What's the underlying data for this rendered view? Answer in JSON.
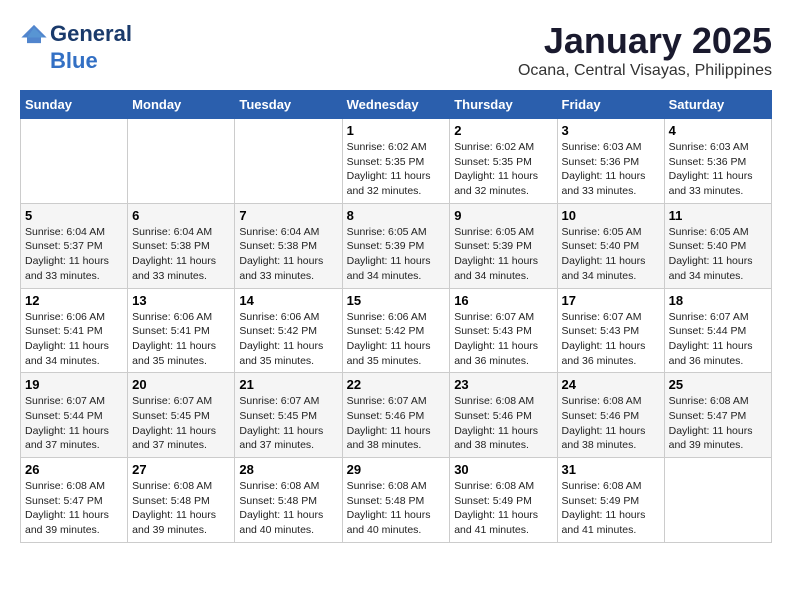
{
  "header": {
    "logo_general": "General",
    "logo_blue": "Blue",
    "month_title": "January 2025",
    "location": "Ocana, Central Visayas, Philippines"
  },
  "weekdays": [
    "Sunday",
    "Monday",
    "Tuesday",
    "Wednesday",
    "Thursday",
    "Friday",
    "Saturday"
  ],
  "weeks": [
    [
      {
        "day": "",
        "sunrise": "",
        "sunset": "",
        "daylight": ""
      },
      {
        "day": "",
        "sunrise": "",
        "sunset": "",
        "daylight": ""
      },
      {
        "day": "",
        "sunrise": "",
        "sunset": "",
        "daylight": ""
      },
      {
        "day": "1",
        "sunrise": "Sunrise: 6:02 AM",
        "sunset": "Sunset: 5:35 PM",
        "daylight": "Daylight: 11 hours and 32 minutes."
      },
      {
        "day": "2",
        "sunrise": "Sunrise: 6:02 AM",
        "sunset": "Sunset: 5:35 PM",
        "daylight": "Daylight: 11 hours and 32 minutes."
      },
      {
        "day": "3",
        "sunrise": "Sunrise: 6:03 AM",
        "sunset": "Sunset: 5:36 PM",
        "daylight": "Daylight: 11 hours and 33 minutes."
      },
      {
        "day": "4",
        "sunrise": "Sunrise: 6:03 AM",
        "sunset": "Sunset: 5:36 PM",
        "daylight": "Daylight: 11 hours and 33 minutes."
      }
    ],
    [
      {
        "day": "5",
        "sunrise": "Sunrise: 6:04 AM",
        "sunset": "Sunset: 5:37 PM",
        "daylight": "Daylight: 11 hours and 33 minutes."
      },
      {
        "day": "6",
        "sunrise": "Sunrise: 6:04 AM",
        "sunset": "Sunset: 5:38 PM",
        "daylight": "Daylight: 11 hours and 33 minutes."
      },
      {
        "day": "7",
        "sunrise": "Sunrise: 6:04 AM",
        "sunset": "Sunset: 5:38 PM",
        "daylight": "Daylight: 11 hours and 33 minutes."
      },
      {
        "day": "8",
        "sunrise": "Sunrise: 6:05 AM",
        "sunset": "Sunset: 5:39 PM",
        "daylight": "Daylight: 11 hours and 34 minutes."
      },
      {
        "day": "9",
        "sunrise": "Sunrise: 6:05 AM",
        "sunset": "Sunset: 5:39 PM",
        "daylight": "Daylight: 11 hours and 34 minutes."
      },
      {
        "day": "10",
        "sunrise": "Sunrise: 6:05 AM",
        "sunset": "Sunset: 5:40 PM",
        "daylight": "Daylight: 11 hours and 34 minutes."
      },
      {
        "day": "11",
        "sunrise": "Sunrise: 6:05 AM",
        "sunset": "Sunset: 5:40 PM",
        "daylight": "Daylight: 11 hours and 34 minutes."
      }
    ],
    [
      {
        "day": "12",
        "sunrise": "Sunrise: 6:06 AM",
        "sunset": "Sunset: 5:41 PM",
        "daylight": "Daylight: 11 hours and 34 minutes."
      },
      {
        "day": "13",
        "sunrise": "Sunrise: 6:06 AM",
        "sunset": "Sunset: 5:41 PM",
        "daylight": "Daylight: 11 hours and 35 minutes."
      },
      {
        "day": "14",
        "sunrise": "Sunrise: 6:06 AM",
        "sunset": "Sunset: 5:42 PM",
        "daylight": "Daylight: 11 hours and 35 minutes."
      },
      {
        "day": "15",
        "sunrise": "Sunrise: 6:06 AM",
        "sunset": "Sunset: 5:42 PM",
        "daylight": "Daylight: 11 hours and 35 minutes."
      },
      {
        "day": "16",
        "sunrise": "Sunrise: 6:07 AM",
        "sunset": "Sunset: 5:43 PM",
        "daylight": "Daylight: 11 hours and 36 minutes."
      },
      {
        "day": "17",
        "sunrise": "Sunrise: 6:07 AM",
        "sunset": "Sunset: 5:43 PM",
        "daylight": "Daylight: 11 hours and 36 minutes."
      },
      {
        "day": "18",
        "sunrise": "Sunrise: 6:07 AM",
        "sunset": "Sunset: 5:44 PM",
        "daylight": "Daylight: 11 hours and 36 minutes."
      }
    ],
    [
      {
        "day": "19",
        "sunrise": "Sunrise: 6:07 AM",
        "sunset": "Sunset: 5:44 PM",
        "daylight": "Daylight: 11 hours and 37 minutes."
      },
      {
        "day": "20",
        "sunrise": "Sunrise: 6:07 AM",
        "sunset": "Sunset: 5:45 PM",
        "daylight": "Daylight: 11 hours and 37 minutes."
      },
      {
        "day": "21",
        "sunrise": "Sunrise: 6:07 AM",
        "sunset": "Sunset: 5:45 PM",
        "daylight": "Daylight: 11 hours and 37 minutes."
      },
      {
        "day": "22",
        "sunrise": "Sunrise: 6:07 AM",
        "sunset": "Sunset: 5:46 PM",
        "daylight": "Daylight: 11 hours and 38 minutes."
      },
      {
        "day": "23",
        "sunrise": "Sunrise: 6:08 AM",
        "sunset": "Sunset: 5:46 PM",
        "daylight": "Daylight: 11 hours and 38 minutes."
      },
      {
        "day": "24",
        "sunrise": "Sunrise: 6:08 AM",
        "sunset": "Sunset: 5:46 PM",
        "daylight": "Daylight: 11 hours and 38 minutes."
      },
      {
        "day": "25",
        "sunrise": "Sunrise: 6:08 AM",
        "sunset": "Sunset: 5:47 PM",
        "daylight": "Daylight: 11 hours and 39 minutes."
      }
    ],
    [
      {
        "day": "26",
        "sunrise": "Sunrise: 6:08 AM",
        "sunset": "Sunset: 5:47 PM",
        "daylight": "Daylight: 11 hours and 39 minutes."
      },
      {
        "day": "27",
        "sunrise": "Sunrise: 6:08 AM",
        "sunset": "Sunset: 5:48 PM",
        "daylight": "Daylight: 11 hours and 39 minutes."
      },
      {
        "day": "28",
        "sunrise": "Sunrise: 6:08 AM",
        "sunset": "Sunset: 5:48 PM",
        "daylight": "Daylight: 11 hours and 40 minutes."
      },
      {
        "day": "29",
        "sunrise": "Sunrise: 6:08 AM",
        "sunset": "Sunset: 5:48 PM",
        "daylight": "Daylight: 11 hours and 40 minutes."
      },
      {
        "day": "30",
        "sunrise": "Sunrise: 6:08 AM",
        "sunset": "Sunset: 5:49 PM",
        "daylight": "Daylight: 11 hours and 41 minutes."
      },
      {
        "day": "31",
        "sunrise": "Sunrise: 6:08 AM",
        "sunset": "Sunset: 5:49 PM",
        "daylight": "Daylight: 11 hours and 41 minutes."
      },
      {
        "day": "",
        "sunrise": "",
        "sunset": "",
        "daylight": ""
      }
    ]
  ]
}
